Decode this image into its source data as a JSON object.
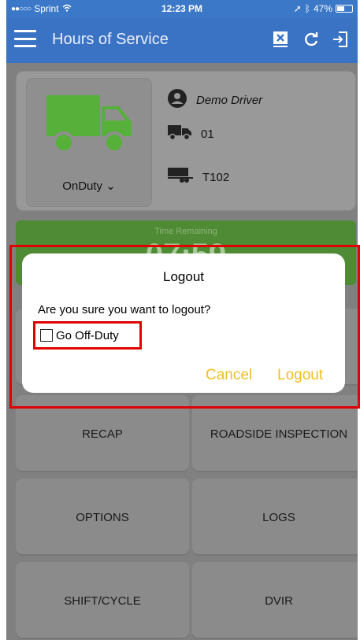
{
  "status_bar": {
    "carrier": "Sprint",
    "time": "12:23 PM",
    "battery": "47%"
  },
  "app_bar": {
    "title": "Hours of Service",
    "icons": [
      "hamburger-menu-icon",
      "exit-icon",
      "refresh-icon",
      "logout-icon"
    ]
  },
  "driver": {
    "status_label": "OnDuty",
    "name": "Demo Driver",
    "vehicle": "01",
    "trailer": "T102"
  },
  "time_remaining": {
    "label": "Time Remaining",
    "value": "07:59"
  },
  "tiles": [
    {
      "label": "RECAP"
    },
    {
      "label": "ROADSIDE INSPECTION"
    },
    {
      "label": "OPTIONS"
    },
    {
      "label": "LOGS"
    },
    {
      "label": "SHIFT/CYCLE"
    },
    {
      "label": "DVIR"
    }
  ],
  "dialog": {
    "title": "Logout",
    "message": "Are you sure you want to logout?",
    "checkbox_label": "Go Off-Duty",
    "checkbox_checked": false,
    "cancel_label": "Cancel",
    "logout_label": "Logout"
  },
  "colors": {
    "app_bar": "#3b73c4",
    "truck_green": "#56b03a",
    "dialog_button": "#f2bf1f",
    "highlight": "#e00000"
  }
}
